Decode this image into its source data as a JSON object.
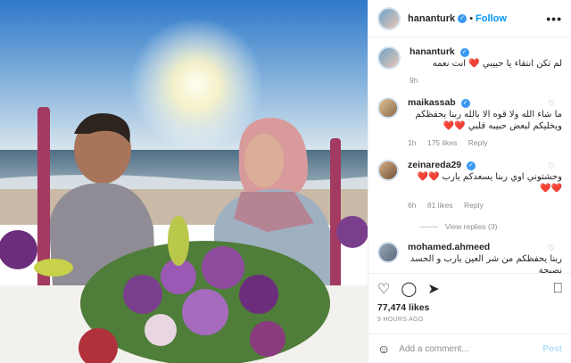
{
  "header": {
    "username": "hananturk",
    "dot": "•",
    "follow_label": "Follow",
    "more_label": "•••"
  },
  "caption": {
    "username": "hananturk",
    "text": "لم تكن انتقاء يا حبيبي ❤️ انت نعمه",
    "time": "9h"
  },
  "comments": [
    {
      "username": "maikassab",
      "text": "ما شاء الله ولا قوه الا بالله ربنا يحفظكم ويخليكم لبعض حبيبه قلبي ❤️❤️",
      "time": "1h",
      "likes": "175 likes",
      "reply": "Reply"
    },
    {
      "username": "zeinareda29",
      "text": "وحشتوني اوي ربنا يسعدكم يارب ❤️❤️❤️❤️",
      "time": "6h",
      "likes": "81 likes",
      "reply": "Reply",
      "view_replies": "View replies (3)"
    },
    {
      "username": "mohamed.ahmeed",
      "text": "ربنا يحفظكم من شر العين يارب و الحسد نصيحة"
    }
  ],
  "actions": {
    "likes": "77,474 likes",
    "time_ago": "9 HOURS AGO"
  },
  "add_comment": {
    "placeholder": "Add a comment...",
    "post_label": "Post"
  },
  "colors": {
    "accent": "#0095f6",
    "verified": "#3897f0",
    "heart": "#ed4956"
  }
}
